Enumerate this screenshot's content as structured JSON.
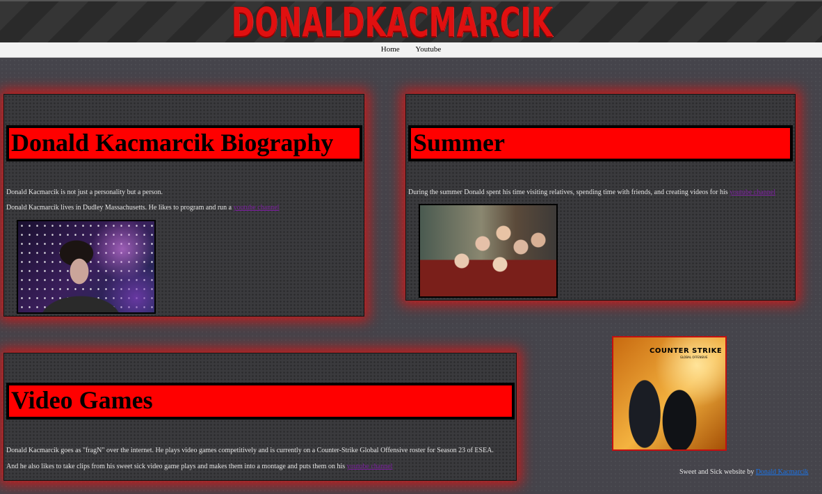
{
  "header": {
    "logo_text": "DONALDKACMARCIK"
  },
  "nav": {
    "items": [
      {
        "label": "Home"
      },
      {
        "label": "Youtube"
      }
    ]
  },
  "biography": {
    "heading": "Donald Kacmarcik Biography",
    "paragraph1": "Donald Kacmarcik is not just a personality but a person.",
    "paragraph2_text": "Donald Kacmarcik lives in Dudley Massachusetts. He likes to program and run a ",
    "paragraph2_link": "youtube channel"
  },
  "summer": {
    "heading": "Summer",
    "paragraph_text": "During the summer Donald spent his time visiting relatives, spending time with friends, and creating videos for his ",
    "paragraph_link": "youtube channel"
  },
  "video_games": {
    "heading": "Video Games",
    "paragraph1": "Donald Kacmarcik goes as \"fragN\" over the internet. He plays video games competitively and is currently on a Counter-Strike Global Offensive roster for Season 23 of ESEA.",
    "paragraph2_text": "And he also likes to take clips from his sweet sick video game plays and makes them into a montage and puts them on his ",
    "paragraph2_link": "youtube channel"
  },
  "csgo_image": {
    "logo_text": "COUNTER STRIKE",
    "sub_text": "GLOBAL OFFENSIVE"
  },
  "footer": {
    "text": "Sweet and Sick website by ",
    "link": "Donald Kacmarcik"
  },
  "colors": {
    "heading_background": "#ff0000",
    "panel_glow": "#dc1414",
    "link_visited": "#7c1fa0",
    "footer_link": "#1a73e8"
  }
}
